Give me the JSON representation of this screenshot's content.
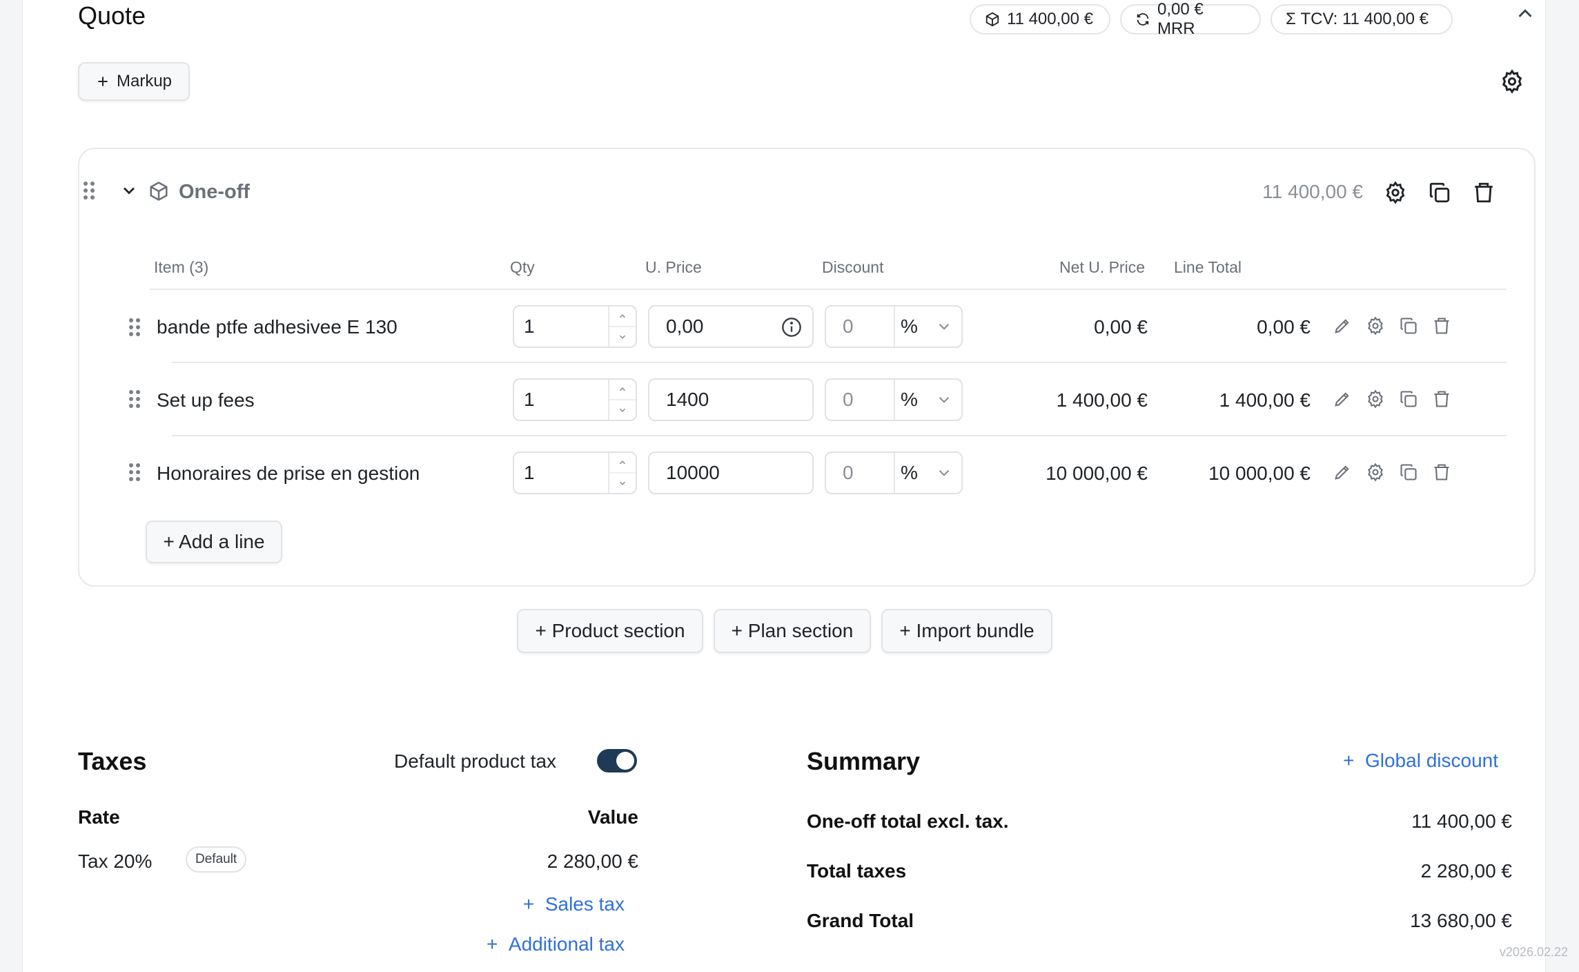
{
  "header": {
    "title": "Quote",
    "pills": [
      {
        "icon": "box-icon",
        "label": "11 400,00 €"
      },
      {
        "icon": "refresh-icon",
        "label": "0,00 € MRR"
      },
      {
        "icon": "sigma-icon",
        "label": "Σ TCV: 11 400,00 €"
      }
    ]
  },
  "toolbar": {
    "markup_label": "Markup"
  },
  "section": {
    "name": "One-off",
    "total": "11 400,00 €",
    "columns": {
      "item": "Item (3)",
      "qty": "Qty",
      "uprice": "U. Price",
      "discount": "Discount",
      "net": "Net U. Price",
      "line_total": "Line Total"
    },
    "rows": [
      {
        "name": "bande ptfe adhesivee E 130",
        "qty": "1",
        "uprice": "0,00",
        "discount": "0",
        "unit": "%",
        "net": "0,00 €",
        "total": "0,00 €"
      },
      {
        "name": "Set up fees",
        "qty": "1",
        "uprice": "1400",
        "discount": "0",
        "unit": "%",
        "net": "1 400,00 €",
        "total": "1 400,00 €"
      },
      {
        "name": "Honoraires de prise en gestion",
        "qty": "1",
        "uprice": "10000",
        "discount": "0",
        "unit": "%",
        "net": "10 000,00 €",
        "total": "10 000,00 €"
      }
    ],
    "add_line_label": "+ Add a line"
  },
  "section_buttons": {
    "product": "+ Product section",
    "plan": "+ Plan section",
    "bundle": "+ Import bundle"
  },
  "taxes": {
    "title": "Taxes",
    "default_toggle_label": "Default product tax",
    "default_toggle_on": true,
    "rate_header": "Rate",
    "value_header": "Value",
    "rows": [
      {
        "name": "Tax 20%",
        "badge": "Default",
        "value": "2 280,00 €"
      }
    ],
    "add_sales_tax": "Sales tax",
    "add_additional_tax": "Additional tax"
  },
  "summary": {
    "title": "Summary",
    "global_discount": "Global discount",
    "lines": [
      {
        "label": "One-off total excl. tax.",
        "value": "11 400,00 €"
      },
      {
        "label": "Total taxes",
        "value": "2 280,00 €"
      },
      {
        "label": "Grand Total",
        "value": "13 680,00 €"
      }
    ]
  },
  "footer": {
    "version": "v2026.02.22"
  },
  "colors": {
    "accent": "#2f6fdb",
    "toggle": "#1f3a56"
  }
}
